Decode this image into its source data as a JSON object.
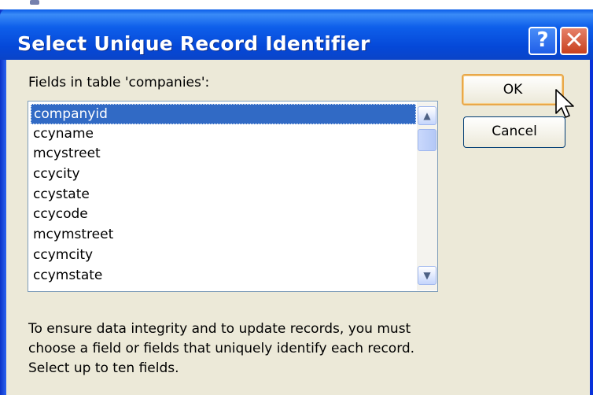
{
  "dialog": {
    "title": "Select Unique Record Identifier",
    "help_button": "?",
    "close_button": "✕",
    "fields_label": "Fields in table 'companies':",
    "fields": [
      {
        "label": "companyid",
        "selected": true
      },
      {
        "label": "ccyname",
        "selected": false
      },
      {
        "label": "mcystreet",
        "selected": false
      },
      {
        "label": "ccycity",
        "selected": false
      },
      {
        "label": "ccystate",
        "selected": false
      },
      {
        "label": "ccycode",
        "selected": false
      },
      {
        "label": "mcymstreet",
        "selected": false
      },
      {
        "label": "ccymcity",
        "selected": false
      },
      {
        "label": "ccymstate",
        "selected": false
      }
    ],
    "ok_label": "OK",
    "cancel_label": "Cancel",
    "info_text": "To ensure data integrity and to update records, you must choose a field or fields that uniquely identify each record. Select up to ten fields."
  },
  "icons": {
    "scroll_up": "chevron-up-icon",
    "scroll_down": "chevron-down-icon",
    "cursor": "mouse-pointer-icon"
  },
  "colors": {
    "selection": "#316ac5",
    "titlebar": "#0a5ce8",
    "dialog_bg": "#ece9d8"
  }
}
